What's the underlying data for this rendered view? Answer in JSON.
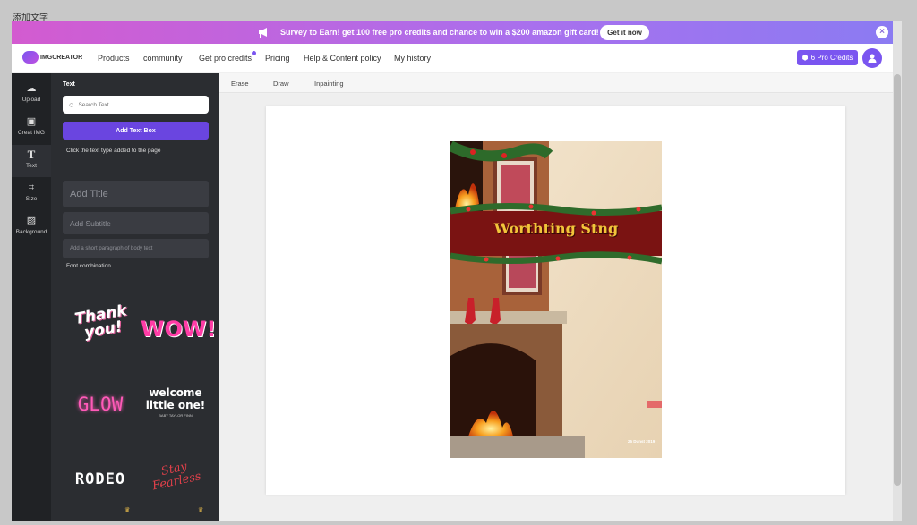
{
  "outer_label": "添加文字",
  "banner": {
    "text": "Survey to Earn! get 100 free pro credits and chance to win a $200 amazon gift card!",
    "button": "Get it now",
    "close_icon": "close-icon",
    "megaphone_icon": "megaphone-icon"
  },
  "nav": {
    "logo": "IMGCREATOR",
    "items": [
      "Products",
      "community",
      "Get pro credits",
      "Pricing",
      "Help & Content policy",
      "My history"
    ],
    "credits": "6 Pro Credits",
    "user_icon": "user-icon"
  },
  "rail": {
    "items": [
      {
        "label": "Upload",
        "icon": "upload-icon"
      },
      {
        "label": "Creat IMG",
        "icon": "image-icon"
      },
      {
        "label": "Text",
        "icon": "text-icon"
      },
      {
        "label": "Size",
        "icon": "crop-icon"
      },
      {
        "label": "Background",
        "icon": "background-icon"
      }
    ]
  },
  "panel": {
    "title": "Text",
    "search_placeholder": "Search Text",
    "add_button": "Add Text Box",
    "hint": "Click the text type added to the page",
    "add_title": "Add Title",
    "add_subtitle": "Add Subtitle",
    "add_body": "Add a short paragraph of body text",
    "font_combination": "Font combination",
    "combos": [
      {
        "text": "Thank you!"
      },
      {
        "text": "WOW!"
      },
      {
        "text": "GLOW"
      },
      {
        "text": "welcome little one!",
        "subtext": "BABY TAYLOR FINN"
      },
      {
        "text": "RODEO"
      },
      {
        "text": "Stay Fearless"
      }
    ]
  },
  "toolbar": {
    "tools": [
      "Erase",
      "Draw",
      "Inpainting"
    ]
  },
  "canvas": {
    "banner_text": "Worthting Stng",
    "caption": "25 Dunst 2019",
    "colors": {
      "accent": "#7a55f0",
      "banner": "#7a1312",
      "banner_text": "#f2c43a"
    }
  }
}
